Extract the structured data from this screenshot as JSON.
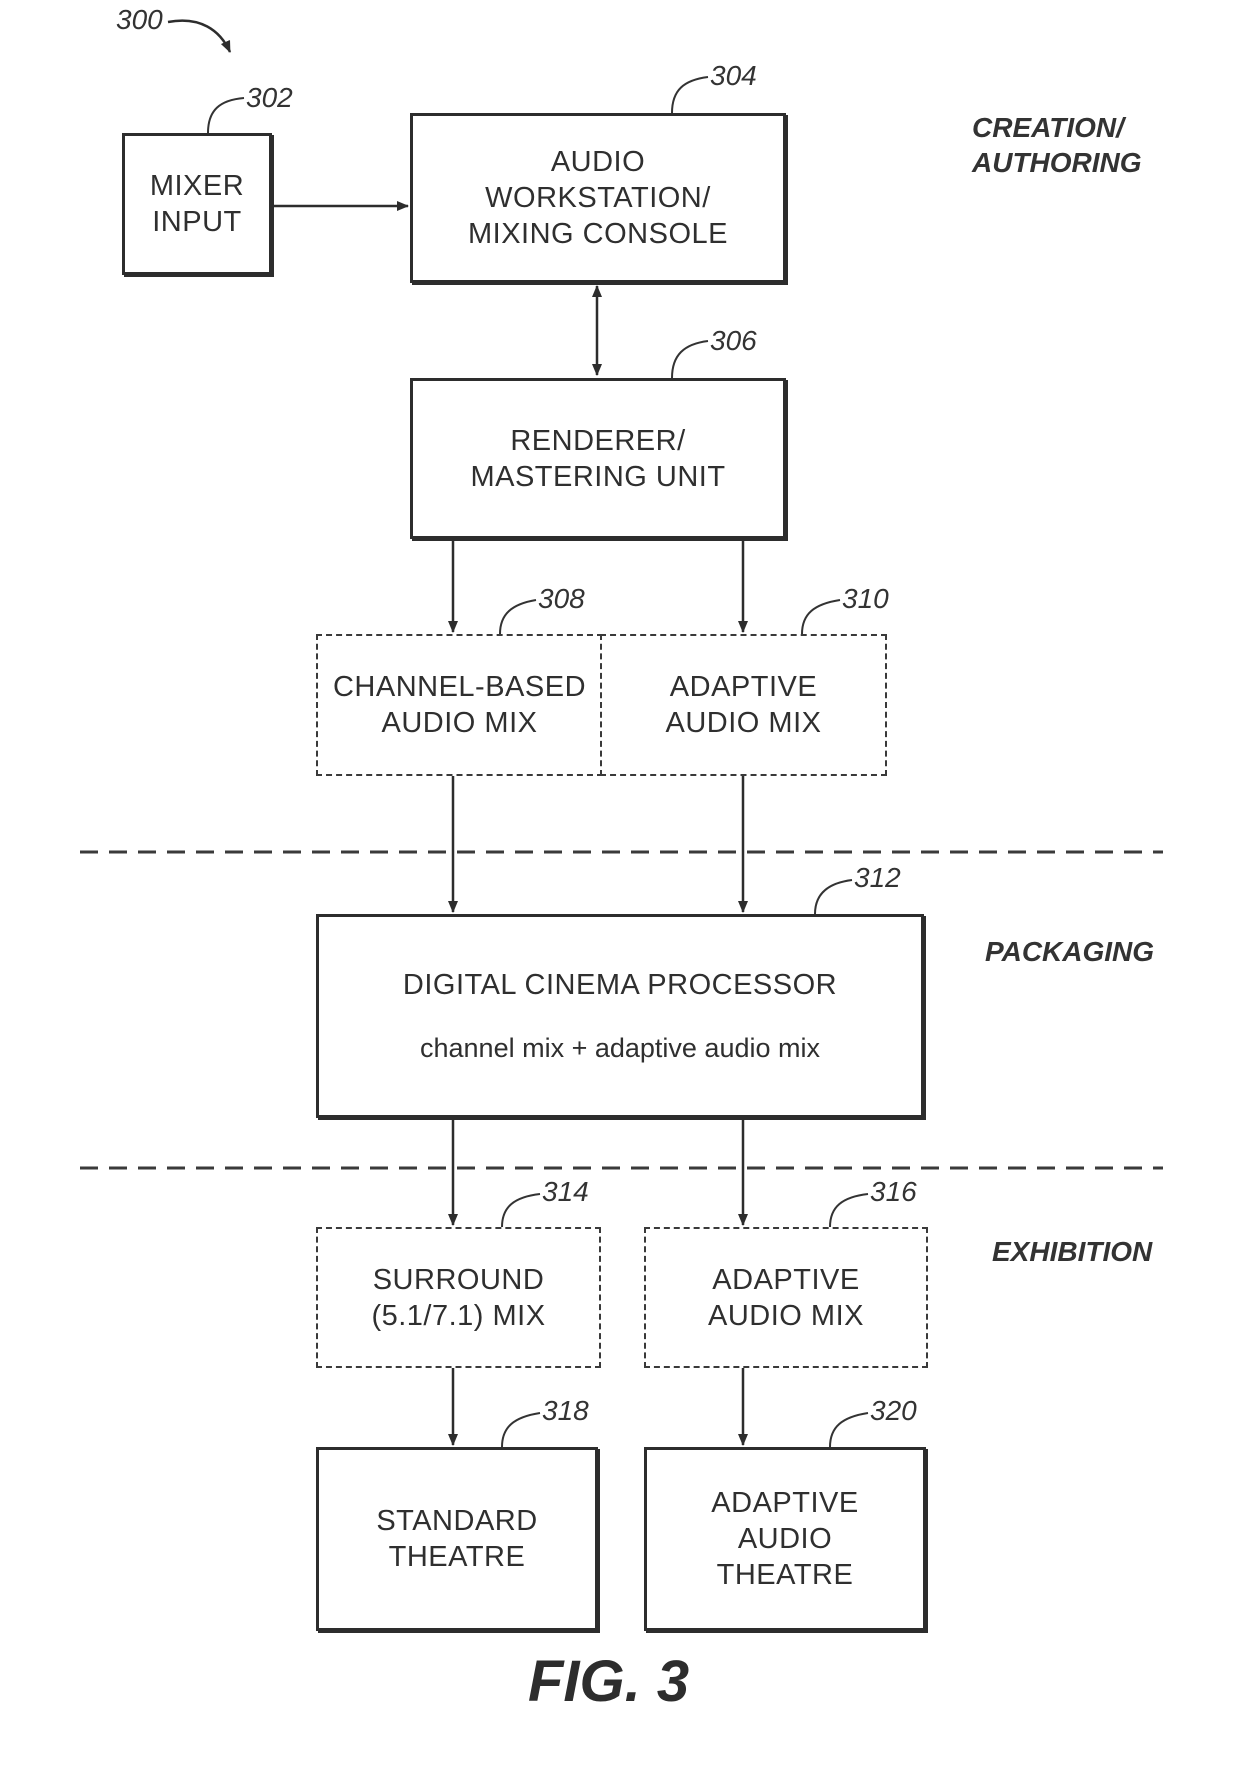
{
  "figure": {
    "ref": "300",
    "caption": "FIG. 3"
  },
  "stages": {
    "creation": [
      "CREATION/",
      "AUTHORING"
    ],
    "packaging": "PACKAGING",
    "exhibition": "EXHIBITION"
  },
  "nodes": {
    "mixer_input": {
      "ref": "302",
      "lines": [
        "MIXER",
        "INPUT"
      ],
      "style": "solid"
    },
    "workstation": {
      "ref": "304",
      "lines": [
        "AUDIO",
        "WORKSTATION/",
        "MIXING CONSOLE"
      ],
      "style": "solid"
    },
    "renderer": {
      "ref": "306",
      "lines": [
        "RENDERER/",
        "MASTERING UNIT"
      ],
      "style": "solid"
    },
    "channel_mix": {
      "ref": "308",
      "lines": [
        "CHANNEL-BASED",
        "AUDIO MIX"
      ],
      "style": "dashed"
    },
    "adaptive_mix": {
      "ref": "310",
      "lines": [
        "ADAPTIVE",
        "AUDIO MIX"
      ],
      "style": "dashed"
    },
    "cinema_processor": {
      "ref": "312",
      "lines": [
        "DIGITAL CINEMA PROCESSOR"
      ],
      "sub": "channel mix + adaptive audio mix",
      "style": "solid"
    },
    "surround_mix": {
      "ref": "314",
      "lines": [
        "SURROUND",
        "(5.1/7.1) MIX"
      ],
      "style": "dashed"
    },
    "adaptive_mix_exhibit": {
      "ref": "316",
      "lines": [
        "ADAPTIVE",
        "AUDIO MIX"
      ],
      "style": "dashed"
    },
    "standard_theatre": {
      "ref": "318",
      "lines": [
        "STANDARD",
        "THEATRE"
      ],
      "style": "solid"
    },
    "adaptive_theatre": {
      "ref": "320",
      "lines": [
        "ADAPTIVE",
        "AUDIO",
        "THEATRE"
      ],
      "style": "solid"
    }
  },
  "edges": [
    {
      "from": "mixer_input",
      "to": "workstation",
      "direction": "forward"
    },
    {
      "from": "workstation",
      "to": "renderer",
      "direction": "bidirectional"
    },
    {
      "from": "renderer",
      "to": "channel_mix",
      "direction": "forward"
    },
    {
      "from": "renderer",
      "to": "adaptive_mix",
      "direction": "forward"
    },
    {
      "from": "channel_mix",
      "to": "cinema_processor",
      "direction": "forward"
    },
    {
      "from": "adaptive_mix",
      "to": "cinema_processor",
      "direction": "forward"
    },
    {
      "from": "cinema_processor",
      "to": "surround_mix",
      "direction": "forward"
    },
    {
      "from": "cinema_processor",
      "to": "adaptive_mix_exhibit",
      "direction": "forward"
    },
    {
      "from": "surround_mix",
      "to": "standard_theatre",
      "direction": "forward"
    },
    {
      "from": "adaptive_mix_exhibit",
      "to": "adaptive_theatre",
      "direction": "forward"
    }
  ]
}
